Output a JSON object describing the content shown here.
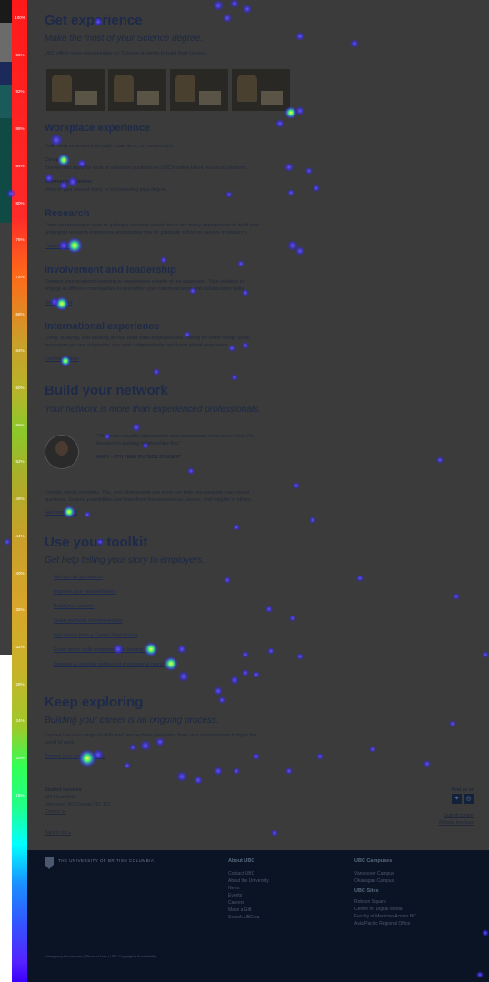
{
  "scale": {
    "ticks": [
      "100%",
      "96%",
      "92%",
      "88%",
      "84%",
      "80%",
      "76%",
      "72%",
      "68%",
      "64%",
      "60%",
      "56%",
      "52%",
      "48%",
      "44%",
      "40%",
      "36%",
      "32%",
      "28%",
      "24%",
      "20%",
      "16%"
    ]
  },
  "experience": {
    "title": "Get experience",
    "subtitle": "Make the most of your Science degree.",
    "intro": "UBC offers many opportunities for Science students to build their careers."
  },
  "workplace": {
    "title": "Workplace experience",
    "line1": "Build work experience through a part-time, on-campus job.",
    "coop_title": "Co-op",
    "coop_text": "Browse and apply for work or volunteer positions on UBC's online talent resources platform.",
    "summer_title": "Summer or Summer",
    "summer_text": "Work in your area of study or in computing your degree."
  },
  "research": {
    "title": "Research",
    "text1": "From volunteering in a lab to getting a research award, there are many opportunities to build your",
    "text2": "undergrad research experience and prepare you for graduate school or careers in research.",
    "link": "Find research"
  },
  "involvement": {
    "title": "Involvement and leadership",
    "text1": "Connect your academic learning to experiences outside of the classroom. Take initiative to",
    "text2": "engage in different communities to strengthen your communication and collaboration skills.",
    "link": "Get involved"
  },
  "international": {
    "title": "International experience",
    "text1": "Living, studying, and working abroad build traits employers are looking for when hiring. Show",
    "text2": "employers you are adaptable, can work independently, and have global experience.",
    "link": "Explore options"
  },
  "network": {
    "title": "Build your network",
    "subtitle": "Your network is more than experienced professionals.",
    "quote1": "\"The most valuable opportunities and connections have come when I've",
    "quote2": "focused on building relationships first.\"",
    "quote_author": "ANDY – 4TH YEAR PHYSICS STUDENT",
    "text1": "Friends, family members, TAs, and other people you meet can help you navigate your career",
    "text2": "questions. Explore possibilities and learn from the experiences, stories, and insights of others.",
    "link": "Get connected"
  },
  "toolkit": {
    "title": "Use your toolkit",
    "subtitle": "Get help telling your story to employers.",
    "items": [
      "Get tips for job search",
      "Improve your resume/letters",
      "Build your resume",
      "Learn methods for interviewing",
      "Get advice from a Career Peer Coach",
      "Know which skills employers are looking for",
      "Develop a LinkedIn profile and professional brand"
    ]
  },
  "exploring": {
    "title": "Keep exploring",
    "subtitle": "Building your career is an ongoing process.",
    "text1": "Explore the wide range of skills and perspectives graduates from your specialization bring to the",
    "text2": "world of work.",
    "link": "Browse your career options"
  },
  "contact": {
    "org": "Student Services",
    "addr1": "1874 East Mall",
    "addr2": "Vancouver, BC Canada V6T 1Z1",
    "link": "Contact us",
    "back": "Back to top",
    "find_us": "Find us on",
    "submit": "Submit content",
    "feedback": "Website feedback"
  },
  "footer": {
    "ubc_name": "THE UNIVERSITY OF BRITISH COLUMBIA",
    "about_title": "About UBC",
    "about_links": [
      "Contact UBC",
      "About the University",
      "News",
      "Events",
      "Careers",
      "Make a Gift",
      "Search UBC.ca"
    ],
    "campus_title": "UBC Campuses",
    "campus_links": [
      "Vancouver Campus",
      "Okanagan Campus"
    ],
    "sites_title": "UBC Sites",
    "sites_links": [
      "Robson Square",
      "Centre for Digital Media",
      "Faculty of Medicine Across BC",
      "Asia Pacific Regional Office"
    ],
    "legal": "Emergency Procedures  |  Terms of Use  |  UBC Copyright  |  Accessibility"
  }
}
